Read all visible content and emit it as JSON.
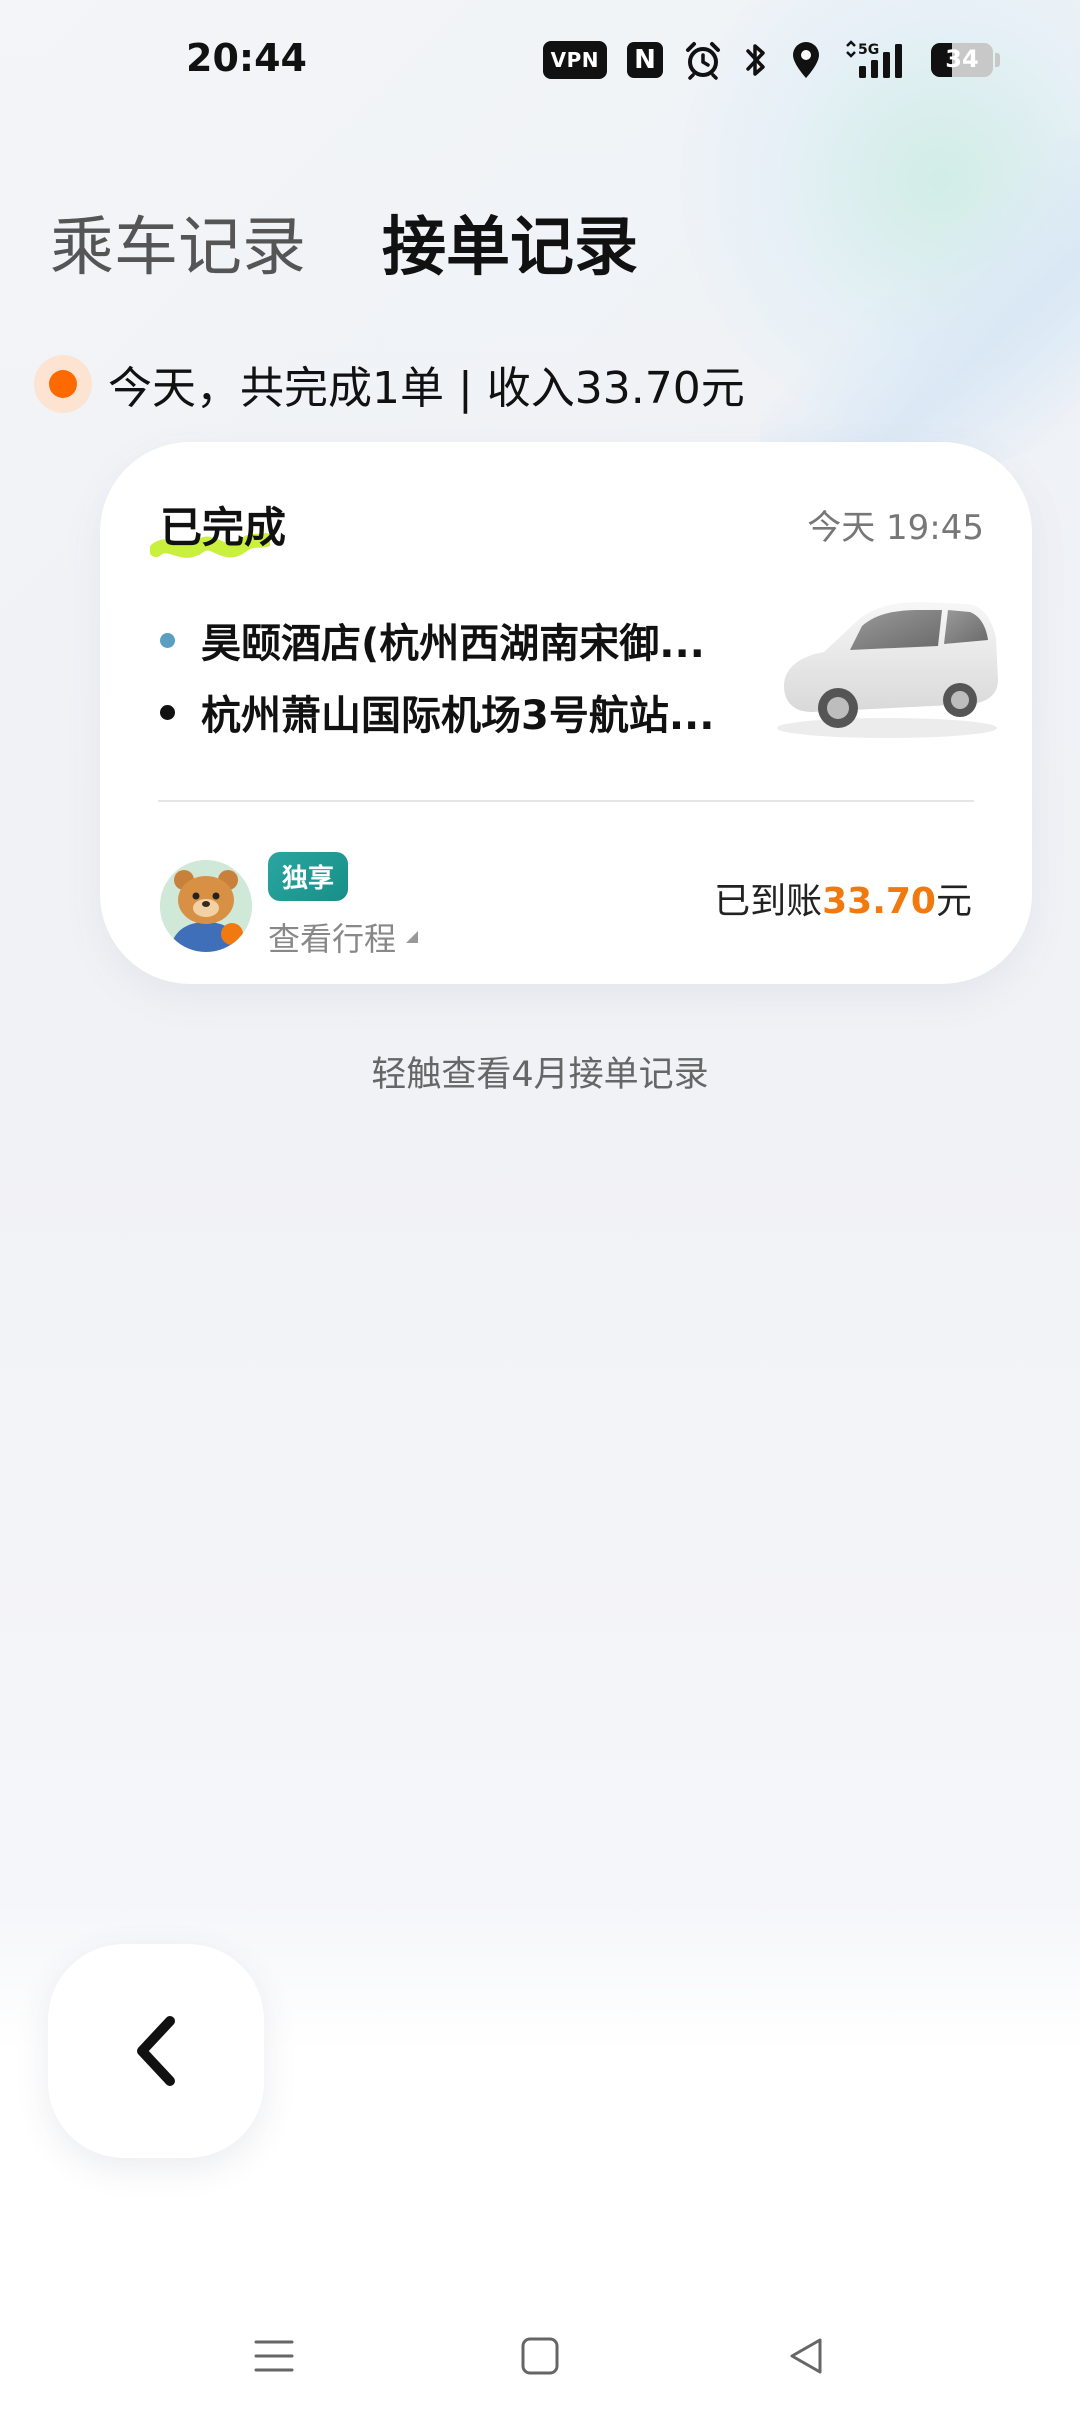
{
  "status_bar": {
    "time": "20:44",
    "vpn_label": "VPN",
    "nfc_label": "N",
    "network_label": "5G",
    "battery_level": "34",
    "icons": [
      "vpn-icon",
      "nfc-icon",
      "alarm-icon",
      "bluetooth-icon",
      "location-icon",
      "signal-5g-icon",
      "battery-icon"
    ]
  },
  "tabs": [
    {
      "label": "乘车记录",
      "active": false
    },
    {
      "label": "接单记录",
      "active": true
    }
  ],
  "summary": {
    "text": "今天，共完成1单 | 收入33.70元"
  },
  "order": {
    "status": "已完成",
    "time": "今天 19:45",
    "origin": "昊颐酒店(杭州西湖南宋御...",
    "destination": "杭州萧山国际机场3号航站...",
    "badge": "独享",
    "view_trip": "查看行程",
    "payout_prefix": "已到账",
    "payout_amount": "33.70",
    "payout_unit": "元"
  },
  "month_link": "轻触查看4月接单记录",
  "colors": {
    "accent_orange": "#f07a10",
    "dot_orange": "#ff6a00",
    "badge_teal": "#1f9c95",
    "highlight_green": "#c8f03c"
  },
  "nav_bar": {
    "icons": [
      "menu-icon",
      "home-square-icon",
      "back-triangle-icon"
    ]
  }
}
